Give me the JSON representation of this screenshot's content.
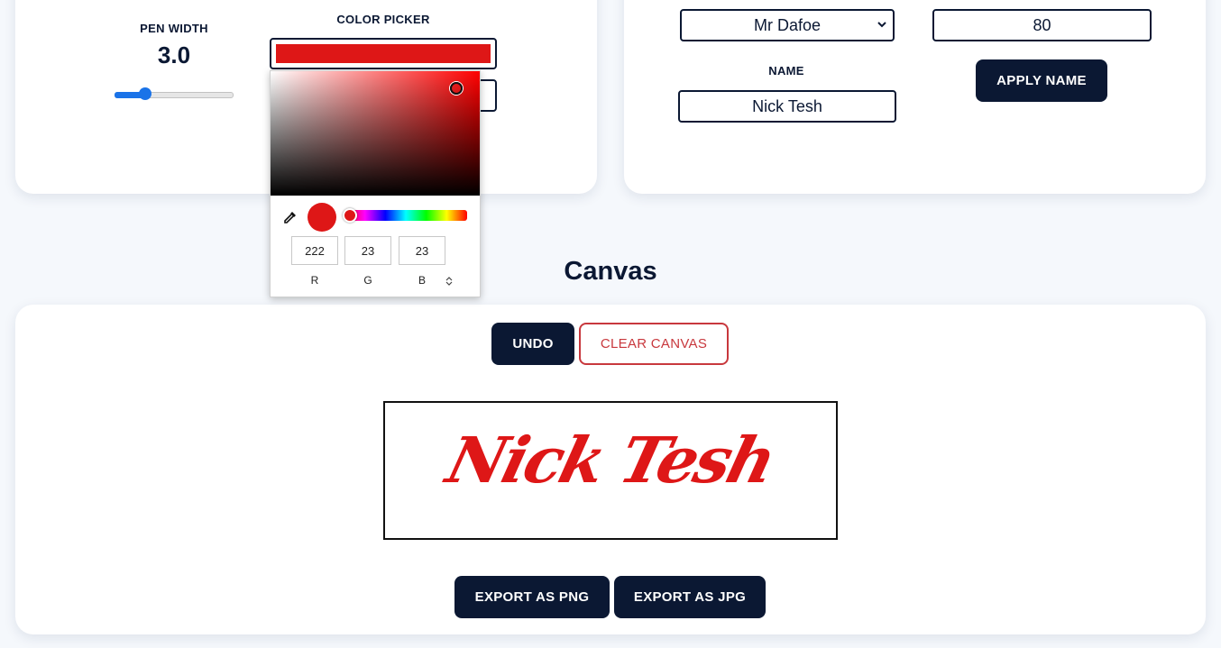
{
  "pen": {
    "label": "PEN WIDTH",
    "value": "3.0",
    "slider_fraction": 0.26
  },
  "color_picker": {
    "label": "COLOR PICKER",
    "current_color": "#de1717",
    "rgb": {
      "r": "222",
      "g": "23",
      "b": "23"
    },
    "channel_labels": {
      "r": "R",
      "g": "G",
      "b": "B"
    }
  },
  "font": {
    "selected": "Mr Dafoe",
    "size_value": "80"
  },
  "name": {
    "label": "NAME",
    "value": "Nick Tesh",
    "apply_label": "APPLY NAME"
  },
  "canvas": {
    "heading": "Canvas",
    "undo_label": "UNDO",
    "clear_label": "CLEAR CANVAS",
    "signature_text": "Nick Tesh",
    "export_png_label": "EXPORT AS PNG",
    "export_jpg_label": "EXPORT AS JPG"
  },
  "colors": {
    "accent": "#0b1833",
    "danger": "#c8383d",
    "ink": "#de1717"
  }
}
